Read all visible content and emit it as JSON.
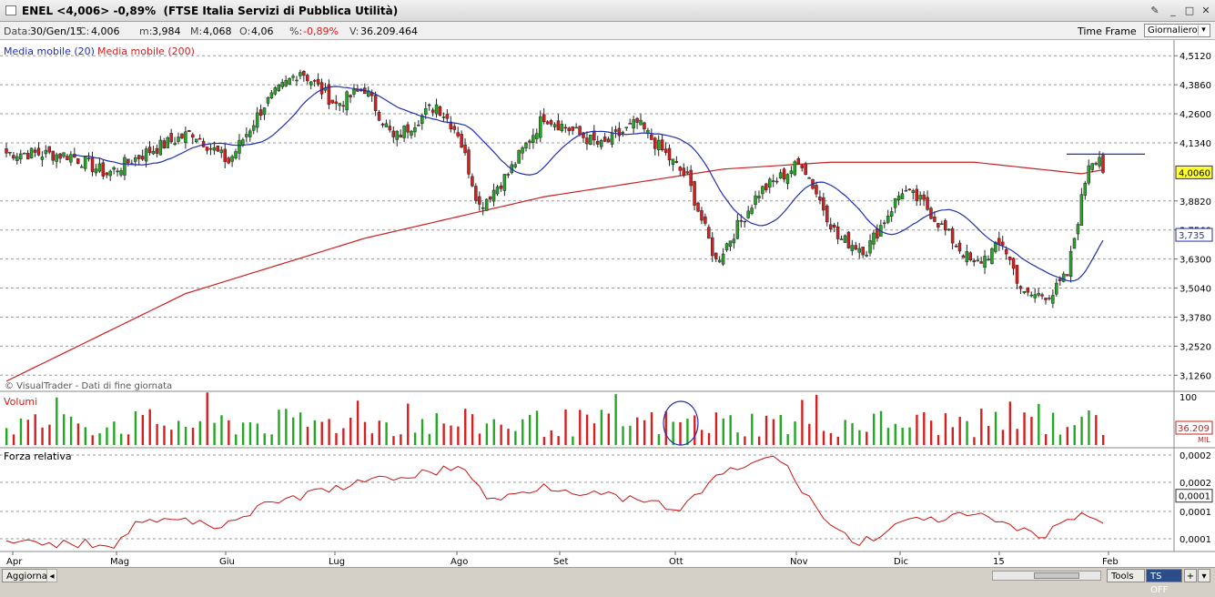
{
  "window": {
    "title": "ENEL <4,006> -0,89%  (FTSE Italia Servizi di Pubblica Utilità)",
    "tools_icon": "wrench-icon",
    "min_icon": "minimize-icon",
    "max_icon": "maximize-icon",
    "close_icon": "close-icon"
  },
  "info": {
    "data_label": "Data:",
    "data_value": "30/Gen/15",
    "c_label": "C:",
    "c_value": "4,006",
    "m_label": "m:",
    "m_value": "3,984",
    "M_label": "M:",
    "M_value": "4,068",
    "o_label": "O:",
    "o_value": "4,06",
    "pct_label": "%:",
    "pct_value": "-0,89%",
    "v_label": "V:",
    "v_value": "36.209.464",
    "time_frame": "Time Frame",
    "period": "Giornaliero"
  },
  "price_panel": {
    "legend_ma20": "Media mobile (20)",
    "legend_ma200": "Media mobile (200)",
    "watermark": "© VisualTrader - Dati di fine giornata",
    "axis_labels": [
      "4,5120",
      "4,3860",
      "4,2600",
      "4,1340",
      "3,8820",
      "3,7560",
      "3,6300",
      "3,5040",
      "3,3780",
      "3,2520",
      "3,1260"
    ],
    "last_price": "4,0060",
    "ma_value": "3,735"
  },
  "volume_panel": {
    "title": "Volumi",
    "scale_max": "100",
    "last_value": "36.209",
    "unit": "MIL"
  },
  "rs_panel": {
    "title": "Forza relativa",
    "axis_labels": [
      "0,0002",
      "0,0002",
      "0,0001",
      "0,0001"
    ],
    "last_value": "0,0001"
  },
  "x_axis": [
    "Apr",
    "Mag",
    "Giu",
    "Lug",
    "Ago",
    "Set",
    "Ott",
    "Nov",
    "Dic",
    "15",
    "Feb"
  ],
  "bottom": {
    "refresh_label": "Aggiorna",
    "tools_label": "Tools",
    "ts_label": "TS OFF",
    "plus_icon": "plus-icon",
    "chevron_icon": "chevron-down-icon"
  },
  "colors": {
    "up": "#22a822",
    "down": "#d42020",
    "ma20": "#1f2fb0",
    "ma200": "#cc1f1f",
    "rs": "#c81414"
  },
  "chart_data": {
    "type": "candlestick",
    "symbol": "ENEL",
    "price_range": [
      3.06,
      4.58
    ],
    "price_anchors": [
      [
        4,
        4.09
      ],
      [
        18,
        4.08
      ],
      [
        28,
        4.0
      ],
      [
        40,
        4.1
      ],
      [
        52,
        4.18
      ],
      [
        62,
        4.05
      ],
      [
        72,
        4.3
      ],
      [
        82,
        4.45
      ],
      [
        92,
        4.3
      ],
      [
        100,
        4.37
      ],
      [
        108,
        4.15
      ],
      [
        120,
        4.3
      ],
      [
        126,
        4.18
      ],
      [
        132,
        3.86
      ],
      [
        140,
        4.0
      ],
      [
        150,
        4.25
      ],
      [
        166,
        4.12
      ],
      [
        176,
        4.22
      ],
      [
        190,
        3.98
      ],
      [
        198,
        3.62
      ],
      [
        210,
        3.92
      ],
      [
        222,
        4.05
      ],
      [
        232,
        3.72
      ],
      [
        240,
        3.67
      ],
      [
        250,
        3.93
      ],
      [
        256,
        3.87
      ],
      [
        262,
        3.75
      ],
      [
        270,
        3.6
      ],
      [
        278,
        3.7
      ],
      [
        284,
        3.47
      ],
      [
        292,
        3.48
      ],
      [
        296,
        3.56
      ],
      [
        302,
        4.05
      ],
      [
        306,
        4.09
      ]
    ],
    "ma200_anchors": [
      [
        0,
        3.1
      ],
      [
        50,
        3.48
      ],
      [
        100,
        3.72
      ],
      [
        150,
        3.9
      ],
      [
        200,
        4.02
      ],
      [
        230,
        4.05
      ],
      [
        270,
        4.05
      ],
      [
        300,
        4.0
      ],
      [
        307,
        4.02
      ]
    ],
    "volume_scale_max": 100,
    "rs_anchors": [
      [
        0,
        5e-05
      ],
      [
        30,
        5e-05
      ],
      [
        38,
        9.2e-05
      ],
      [
        60,
        8.2e-05
      ],
      [
        75,
        0.00012
      ],
      [
        95,
        0.000148
      ],
      [
        115,
        0.000168
      ],
      [
        128,
        0.000178
      ],
      [
        135,
        0.00012
      ],
      [
        150,
        0.000148
      ],
      [
        170,
        0.000128
      ],
      [
        188,
        0.000108
      ],
      [
        200,
        0.000168
      ],
      [
        215,
        0.000198
      ],
      [
        230,
        8e-05
      ],
      [
        238,
        5e-05
      ],
      [
        250,
        8.5e-05
      ],
      [
        270,
        9.8e-05
      ],
      [
        282,
        7.5e-05
      ],
      [
        288,
        6e-05
      ],
      [
        300,
        0.000102
      ],
      [
        306,
        8.5e-05
      ]
    ],
    "rs_range": [
      4e-05,
      0.000205
    ],
    "last_rs": 0.0001
  }
}
